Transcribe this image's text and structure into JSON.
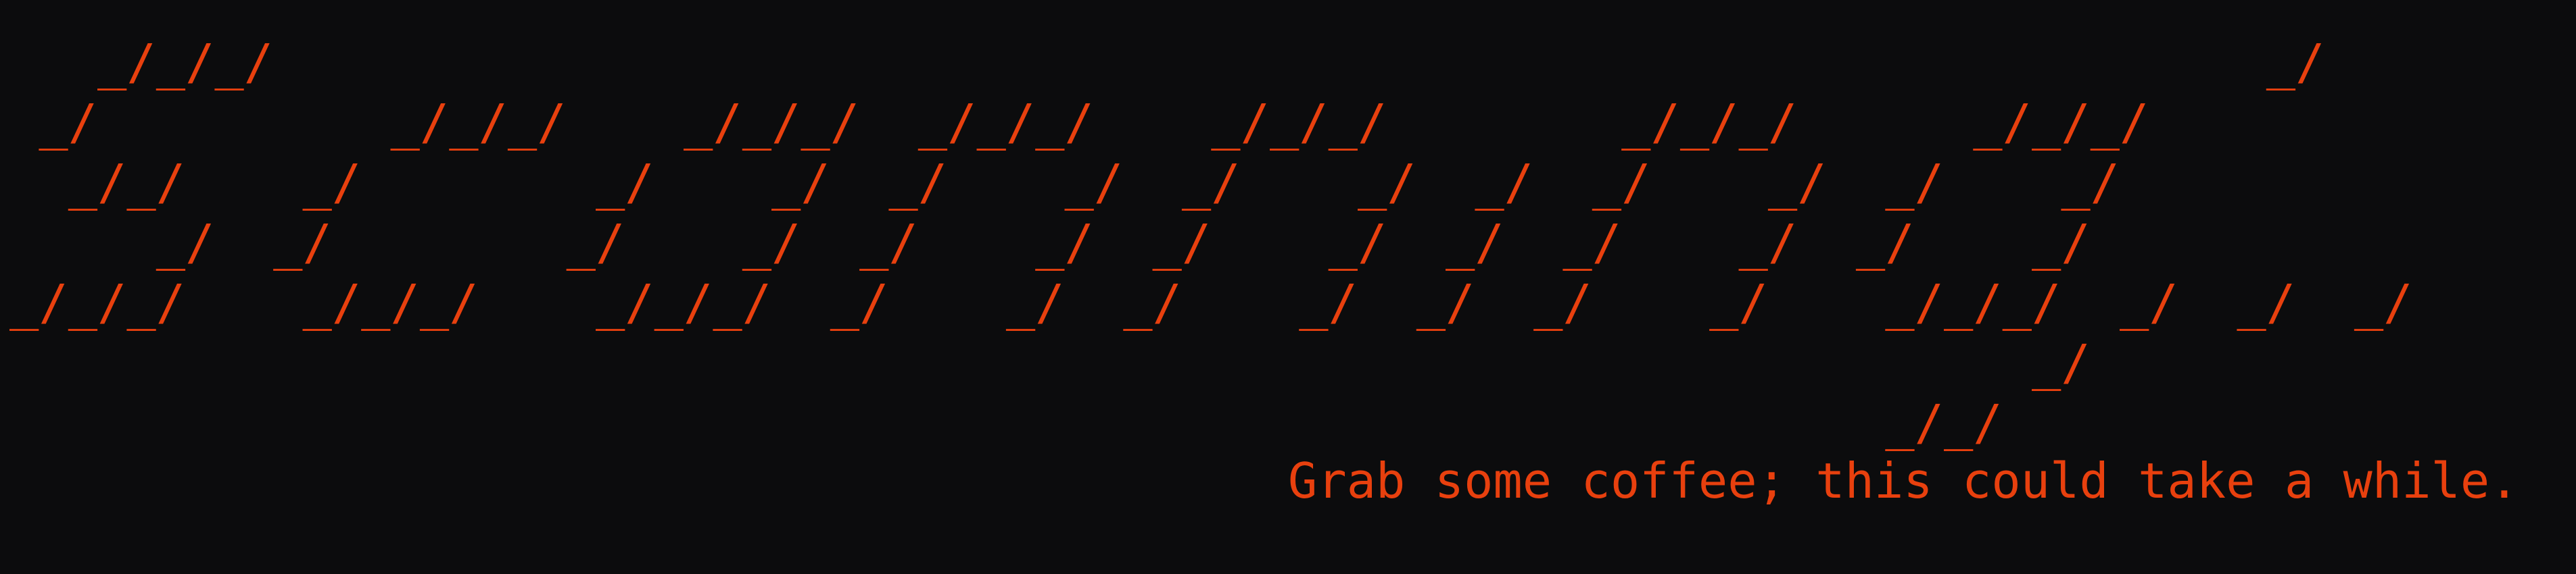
{
  "terminal": {
    "ascii_banner": "   _/_/_/                                                                    _/\n _/          _/_/_/    _/_/_/  _/_/_/    _/_/_/        _/_/_/      _/_/_/\n  _/_/    _/        _/    _/  _/    _/  _/    _/  _/  _/    _/  _/    _/\n     _/  _/        _/    _/  _/    _/  _/    _/  _/  _/    _/  _/    _/\n_/_/_/    _/_/_/    _/_/_/  _/    _/  _/    _/  _/  _/    _/    _/_/_/  _/  _/  _/\n                                                                     _/\n                                                                _/_/",
    "tagline": "Grab some coffee; this could take a while."
  },
  "colors": {
    "background": "#0c0c0d",
    "text": "#e8400e"
  }
}
